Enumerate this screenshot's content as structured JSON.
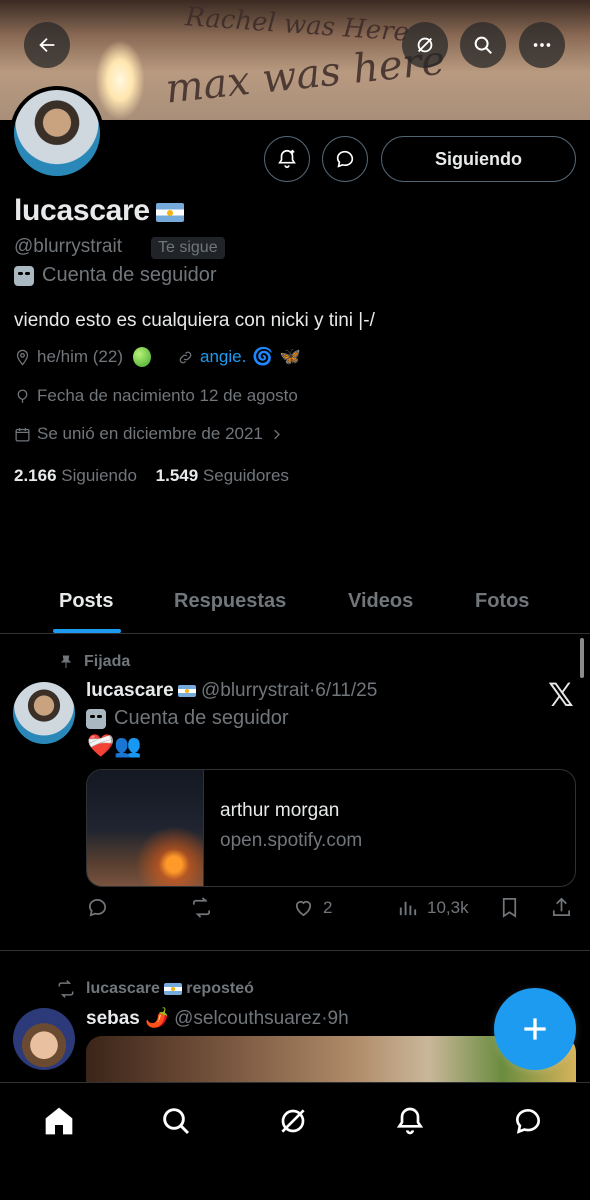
{
  "profile": {
    "name": "lucascare",
    "handle": "@blurrystrait",
    "follows_you_label": "Te sigue",
    "account_type": "Cuenta de seguidor",
    "bio": "viendo esto es cualquiera con nicki y tini |-/",
    "pronouns": "he/him (22)",
    "link_text": "angie.",
    "birthday": "Fecha de nacimiento 12 de agosto",
    "joined": "Se unió en diciembre de 2021",
    "following_count": "2.166",
    "following_label": "Siguiendo",
    "followers_count": "1.549",
    "followers_label": "Seguidores",
    "follow_button": "Siguiendo"
  },
  "banner": {
    "text_line1": "Rachel was Here",
    "text_line2": "max was here"
  },
  "tabs": [
    {
      "label": "Posts",
      "active": true
    },
    {
      "label": "Respuestas",
      "active": false
    },
    {
      "label": "Videos",
      "active": false
    },
    {
      "label": "Fotos",
      "active": false
    }
  ],
  "posts": [
    {
      "pinned_label": "Fijada",
      "author_name": "lucascare",
      "author_handle": "@blurrystrait",
      "date": "6/11/25",
      "account_type": "Cuenta de seguidor",
      "emojis": "❤️‍🩹👥",
      "card_title": "arthur morgan",
      "card_domain": "open.spotify.com",
      "likes": "2",
      "views": "10,3k"
    },
    {
      "repost_label_user": "lucascare",
      "repost_label_text": "reposteó",
      "author_name": "sebas",
      "author_emoji": "🌶️",
      "author_handle": "@selcouthsuarez",
      "date": "9h"
    }
  ],
  "colors": {
    "accent": "#1d9bf0",
    "background": "#000000",
    "text_secondary": "#71767b"
  }
}
